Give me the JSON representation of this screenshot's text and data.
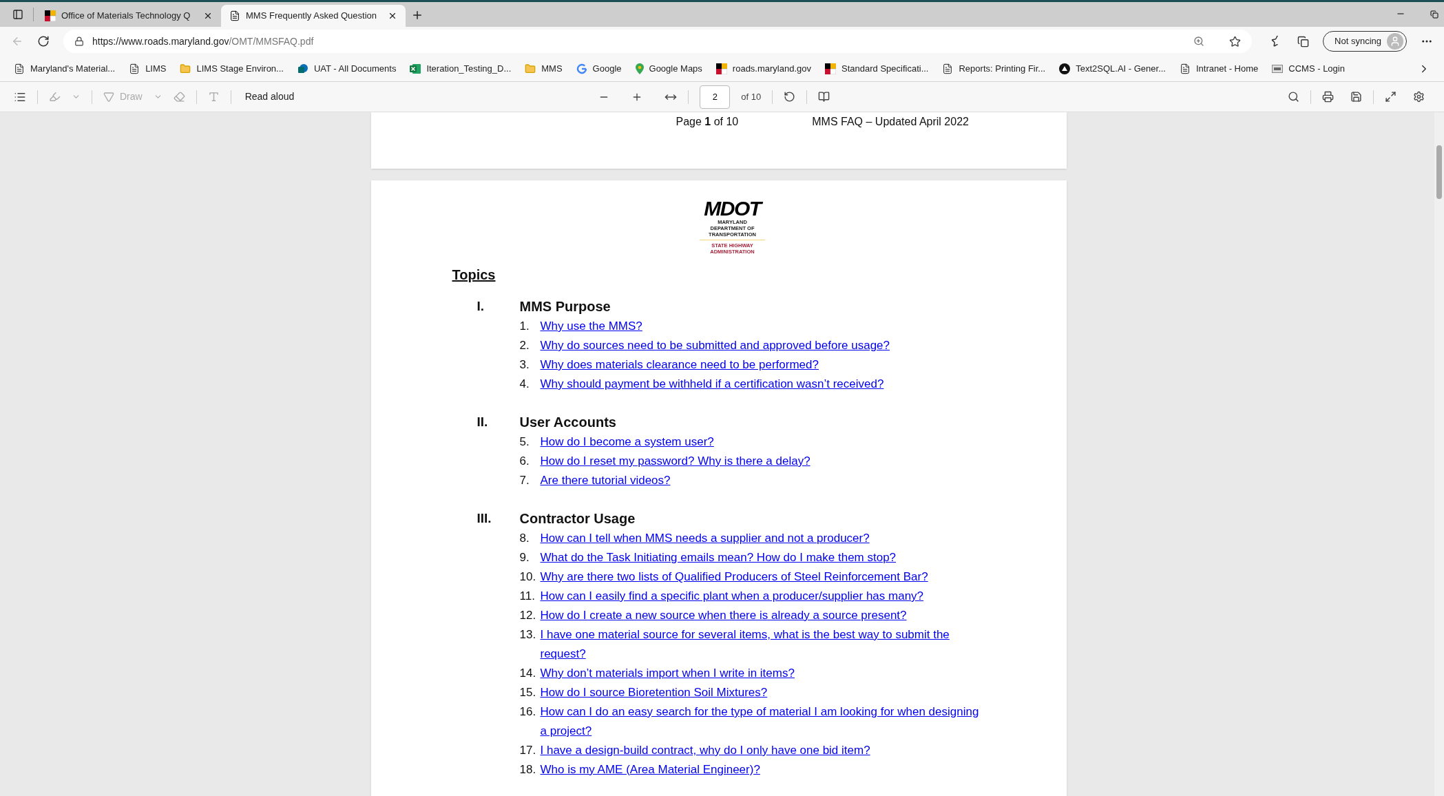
{
  "tabs": [
    {
      "title": "Office of Materials Technology Q",
      "selected": false
    },
    {
      "title": "MMS Frequently Asked Question",
      "selected": true
    }
  ],
  "address_bar": {
    "url_host": "https://www.roads.maryland.gov",
    "url_path": "/OMT/MMSFAQ.pdf"
  },
  "profile": {
    "label": "Not syncing"
  },
  "bookmarks": [
    {
      "label": "Maryland's Material...",
      "kind": "page"
    },
    {
      "label": "LIMS",
      "kind": "page"
    },
    {
      "label": "LIMS Stage Environ...",
      "kind": "folder"
    },
    {
      "label": "UAT - All Documents",
      "kind": "sharepoint"
    },
    {
      "label": "Iteration_Testing_D...",
      "kind": "excel"
    },
    {
      "label": "MMS",
      "kind": "folder"
    },
    {
      "label": "Google",
      "kind": "google"
    },
    {
      "label": "Google Maps",
      "kind": "maps"
    },
    {
      "label": "roads.maryland.gov",
      "kind": "md-flag"
    },
    {
      "label": "Standard Specificati...",
      "kind": "md-flag"
    },
    {
      "label": "Reports: Printing Fir...",
      "kind": "page"
    },
    {
      "label": "Text2SQL.AI - Gener...",
      "kind": "ai"
    },
    {
      "label": "Intranet - Home",
      "kind": "page"
    },
    {
      "label": "CCMS - Login",
      "kind": "ccms"
    }
  ],
  "pdf_toolbar": {
    "draw": {
      "label": "Draw",
      "disabled": true
    },
    "read_aloud": "Read aloud",
    "page_number": "2",
    "page_count": "of 10"
  },
  "previous_page_footer": {
    "page": "Page **1** of 10",
    "title": "MMS FAQ – Updated April 2022"
  },
  "logo": {
    "mark": "MDOT",
    "department": "MARYLAND DEPARTMENT OF TRANSPORTATION",
    "administration": "STATE HIGHWAY ADMINISTRATION"
  },
  "topics_heading": "Topics",
  "sections": [
    {
      "numeral": "I.",
      "title": "MMS Purpose",
      "items": [
        {
          "number": "1.",
          "text": "Why use the MMS?"
        },
        {
          "number": "2.",
          "text": "Why do sources need to be submitted and approved before usage?"
        },
        {
          "number": "3.",
          "text": "Why does materials clearance need to be performed?"
        },
        {
          "number": "4.",
          "text": "Why should payment be withheld if a certification wasn’t received?"
        }
      ]
    },
    {
      "numeral": "II.",
      "title": "User Accounts",
      "items": [
        {
          "number": "5.",
          "text": "How do I become a system user?"
        },
        {
          "number": "6.",
          "text": "How do I reset my password? Why is there a delay?"
        },
        {
          "number": "7.",
          "text": "Are there tutorial videos?"
        }
      ]
    },
    {
      "numeral": "III.",
      "title": "Contractor Usage",
      "items": [
        {
          "number": "8.",
          "text": "How can I tell when MMS needs a supplier and not a producer?"
        },
        {
          "number": "9.",
          "text": "What do the Task Initiating emails mean? How do I make them stop?"
        },
        {
          "number": "10.",
          "text": "Why are there two lists of Qualified Producers of Steel Reinforcement Bar?"
        },
        {
          "number": "11.",
          "text": "How can I easily find a specific plant when a producer/supplier has many?"
        },
        {
          "number": "12.",
          "text": "How do I create a new source when there is already a source present?"
        },
        {
          "number": "13.",
          "text": "I have one material source for several items, what is the best way to submit the request?"
        },
        {
          "number": "14.",
          "text": "Why don’t materials import when I write in items?"
        },
        {
          "number": "15.",
          "text": "How do I source Bioretention Soil Mixtures?"
        },
        {
          "number": "16.",
          "text": "How can I do an easy search for the type of material I am looking for when designing a project?"
        },
        {
          "number": "17.",
          "text": "I have a design-build contract, why do I only have one bid item?"
        },
        {
          "number": "18.",
          "text": "Who is my AME (Area Material Engineer)?"
        }
      ]
    }
  ]
}
